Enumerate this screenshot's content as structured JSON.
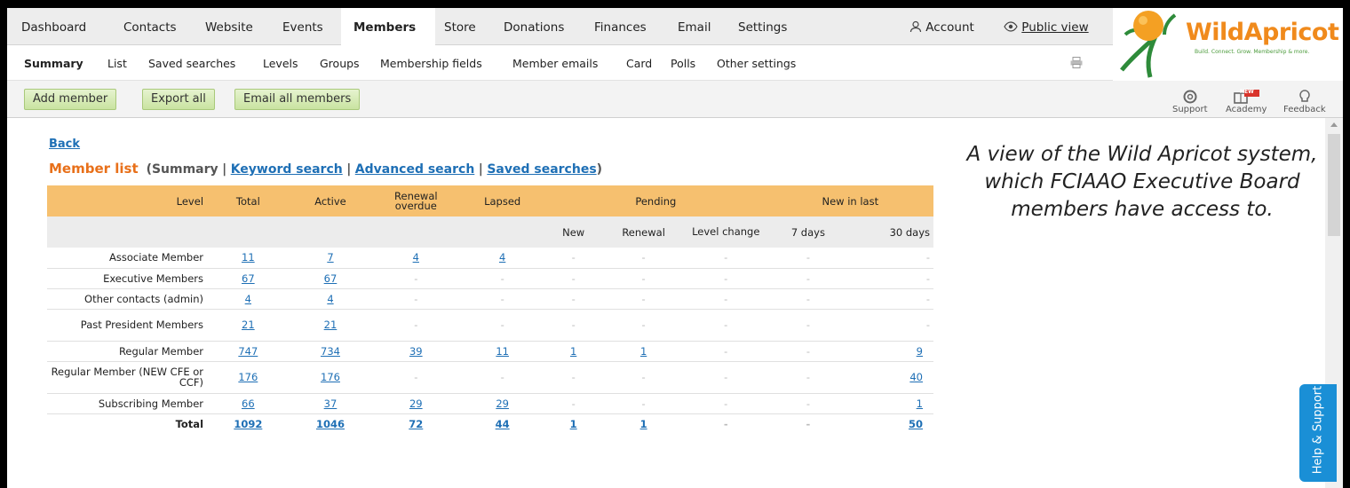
{
  "topnav": {
    "dashboard": "Dashboard",
    "contacts": "Contacts",
    "website": "Website",
    "events": "Events",
    "members": "Members",
    "store": "Store",
    "donations": "Donations",
    "finances": "Finances",
    "email": "Email",
    "settings": "Settings",
    "account": "Account",
    "public_view": "Public view"
  },
  "subnav": {
    "summary": "Summary",
    "list": "List",
    "saved_searches": "Saved searches",
    "levels": "Levels",
    "groups": "Groups",
    "membership_fields": "Membership fields",
    "member_emails": "Member emails",
    "card": "Card",
    "polls": "Polls",
    "other_settings": "Other settings"
  },
  "toolbar": {
    "add_member": "Add member",
    "export_all": "Export all",
    "email_all": "Email all members",
    "support": "Support",
    "academy": "Academy",
    "academy_badge": "NEW",
    "feedback": "Feedback"
  },
  "logo": {
    "name": "WildApricot",
    "tagline": "Build. Connect. Grow.  Membership & more."
  },
  "content": {
    "back": "Back",
    "title": "Member list",
    "summary_label": "(Summary",
    "keyword_search": "Keyword search",
    "advanced_search": "Advanced search",
    "saved_searches": "Saved searches",
    "close_paren": ")"
  },
  "table": {
    "headers": {
      "level": "Level",
      "total": "Total",
      "active": "Active",
      "renewal_overdue": "Renewal overdue",
      "lapsed": "Lapsed",
      "pending": "Pending",
      "new_in_last": "New in last",
      "new": "New",
      "renewal": "Renewal",
      "level_change": "Level change",
      "d7": "7 days",
      "d30": "30 days"
    },
    "rows": [
      {
        "level": "Associate Member",
        "total": "11",
        "active": "7",
        "overdue": "4",
        "lapsed": "4",
        "p_new": "-",
        "p_renewal": "-",
        "p_level": "-",
        "d7": "-",
        "d30": "-"
      },
      {
        "level": "Executive Members",
        "total": "67",
        "active": "67",
        "overdue": "-",
        "lapsed": "-",
        "p_new": "-",
        "p_renewal": "-",
        "p_level": "-",
        "d7": "-",
        "d30": "-"
      },
      {
        "level": "Other contacts (admin)",
        "total": "4",
        "active": "4",
        "overdue": "-",
        "lapsed": "-",
        "p_new": "-",
        "p_renewal": "-",
        "p_level": "-",
        "d7": "-",
        "d30": "-"
      },
      {
        "level": "Past President Members",
        "total": "21",
        "active": "21",
        "overdue": "-",
        "lapsed": "-",
        "p_new": "-",
        "p_renewal": "-",
        "p_level": "-",
        "d7": "-",
        "d30": "-"
      },
      {
        "level": "Regular Member",
        "total": "747",
        "active": "734",
        "overdue": "39",
        "lapsed": "11",
        "p_new": "1",
        "p_renewal": "1",
        "p_level": "-",
        "d7": "-",
        "d30": "9"
      },
      {
        "level": "Regular Member (NEW CFE or CCF)",
        "total": "176",
        "active": "176",
        "overdue": "-",
        "lapsed": "-",
        "p_new": "-",
        "p_renewal": "-",
        "p_level": "-",
        "d7": "-",
        "d30": "40"
      },
      {
        "level": "Subscribing Member",
        "total": "66",
        "active": "37",
        "overdue": "29",
        "lapsed": "29",
        "p_new": "-",
        "p_renewal": "-",
        "p_level": "-",
        "d7": "-",
        "d30": "1"
      },
      {
        "level": "Total",
        "total": "1092",
        "active": "1046",
        "overdue": "72",
        "lapsed": "44",
        "p_new": "1",
        "p_renewal": "1",
        "p_level": "-",
        "d7": "-",
        "d30": "50"
      }
    ]
  },
  "caption": "A view of the Wild Apricot system, which FCIAAO Executive Board members have access to.",
  "help_tab": "Help & Support",
  "colors": {
    "header_orange": "#f6c06f",
    "link_blue": "#1e6fb5",
    "title_orange": "#e8701a",
    "button_green": "#c9e3a1",
    "help_blue": "#1a8fd6"
  }
}
